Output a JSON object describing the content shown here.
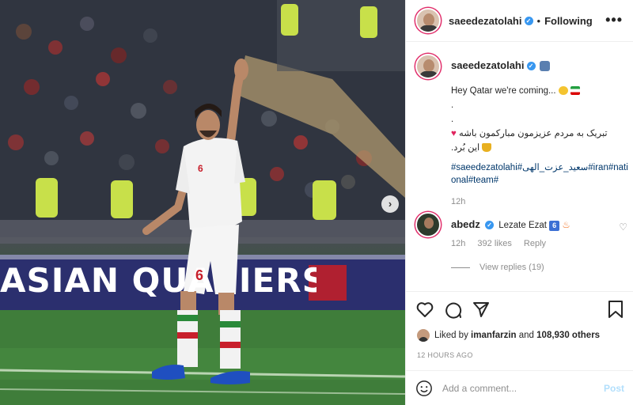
{
  "photo": {
    "banner_text": "ASIAN QUA  IERS",
    "jersey_number": "6",
    "next_icon": "chevron-right-icon"
  },
  "header": {
    "username": "saeedezatolahi",
    "separator": "•",
    "follow_state": "Following",
    "more_label": "•••"
  },
  "caption": {
    "username": "saeedezatolahi",
    "line1": "Hey Qatar  we're coming...",
    "line2": ".",
    "line3": ".",
    "line4": "تبریک به مردم عزیزمون مبارکمون باشه",
    "line5": ".این بُرد",
    "hashtags": "#saeedezatolahi#سعید_عزت_الهی#iran#national#team#",
    "time": "12h"
  },
  "comment": {
    "username": "abedz",
    "text": "Lezate Ezat",
    "badge": "6",
    "time": "12h",
    "likes": "392 likes",
    "reply": "Reply",
    "view_replies": "View replies (19)"
  },
  "likes": {
    "liked_by_prefix": "Liked by",
    "liked_user": "imanfarzin",
    "and_text": "and",
    "count_text": "108,930 others"
  },
  "time_ago": "12 HOURS AGO",
  "add_comment": {
    "placeholder": "Add a comment...",
    "post_label": "Post"
  },
  "colors": {
    "accent_link": "#00376b",
    "verified": "#3897f0",
    "post_disabled": "#b2dffc",
    "muted": "#8e8e8e"
  }
}
